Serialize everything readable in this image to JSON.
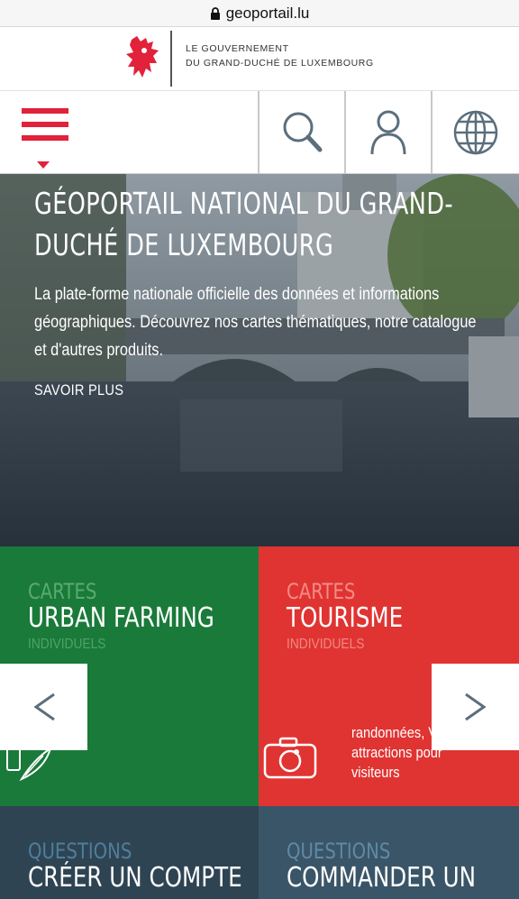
{
  "browser": {
    "url": "geoportail.lu"
  },
  "gov": {
    "line1": "LE GOUVERNEMENT",
    "line2": "DU GRAND-DUCHÉ DE LUXEMBOURG"
  },
  "nav": {
    "menu_icon": "hamburger-icon",
    "search_icon": "search-icon",
    "user_icon": "user-icon",
    "language_icon": "globe-icon"
  },
  "hero": {
    "title": "GÉOPORTAIL NATIONAL DU GRAND-DUCHÉ DE LUXEMBOURG",
    "description": "La plate-forme nationale officielle des données et informations géographiques. Découvrez nos cartes thématiques, notre catalogue et d'autres produits.",
    "link": "SAVOIR PLUS"
  },
  "cards": [
    {
      "kicker": "CARTES",
      "title": "URBAN FARMING",
      "sub": "INDIVIDUELS",
      "color": "#1a7a3a",
      "icon": "urban-farming-icon"
    },
    {
      "kicker": "CARTES",
      "title": "TOURISME",
      "sub": "INDIVIDUELS",
      "color": "#e03432",
      "icon": "camera-icon",
      "desc": "randonnées, VTT, et attractions pour visiteurs"
    },
    {
      "kicker": "QUESTIONS",
      "title": "CRÉER UN COMPTE",
      "color": "#2f4453"
    },
    {
      "kicker": "QUESTIONS",
      "title": "COMMANDER UN",
      "color": "#3a5567"
    }
  ],
  "carousel": {
    "prev_label": "<",
    "next_label": ">"
  }
}
